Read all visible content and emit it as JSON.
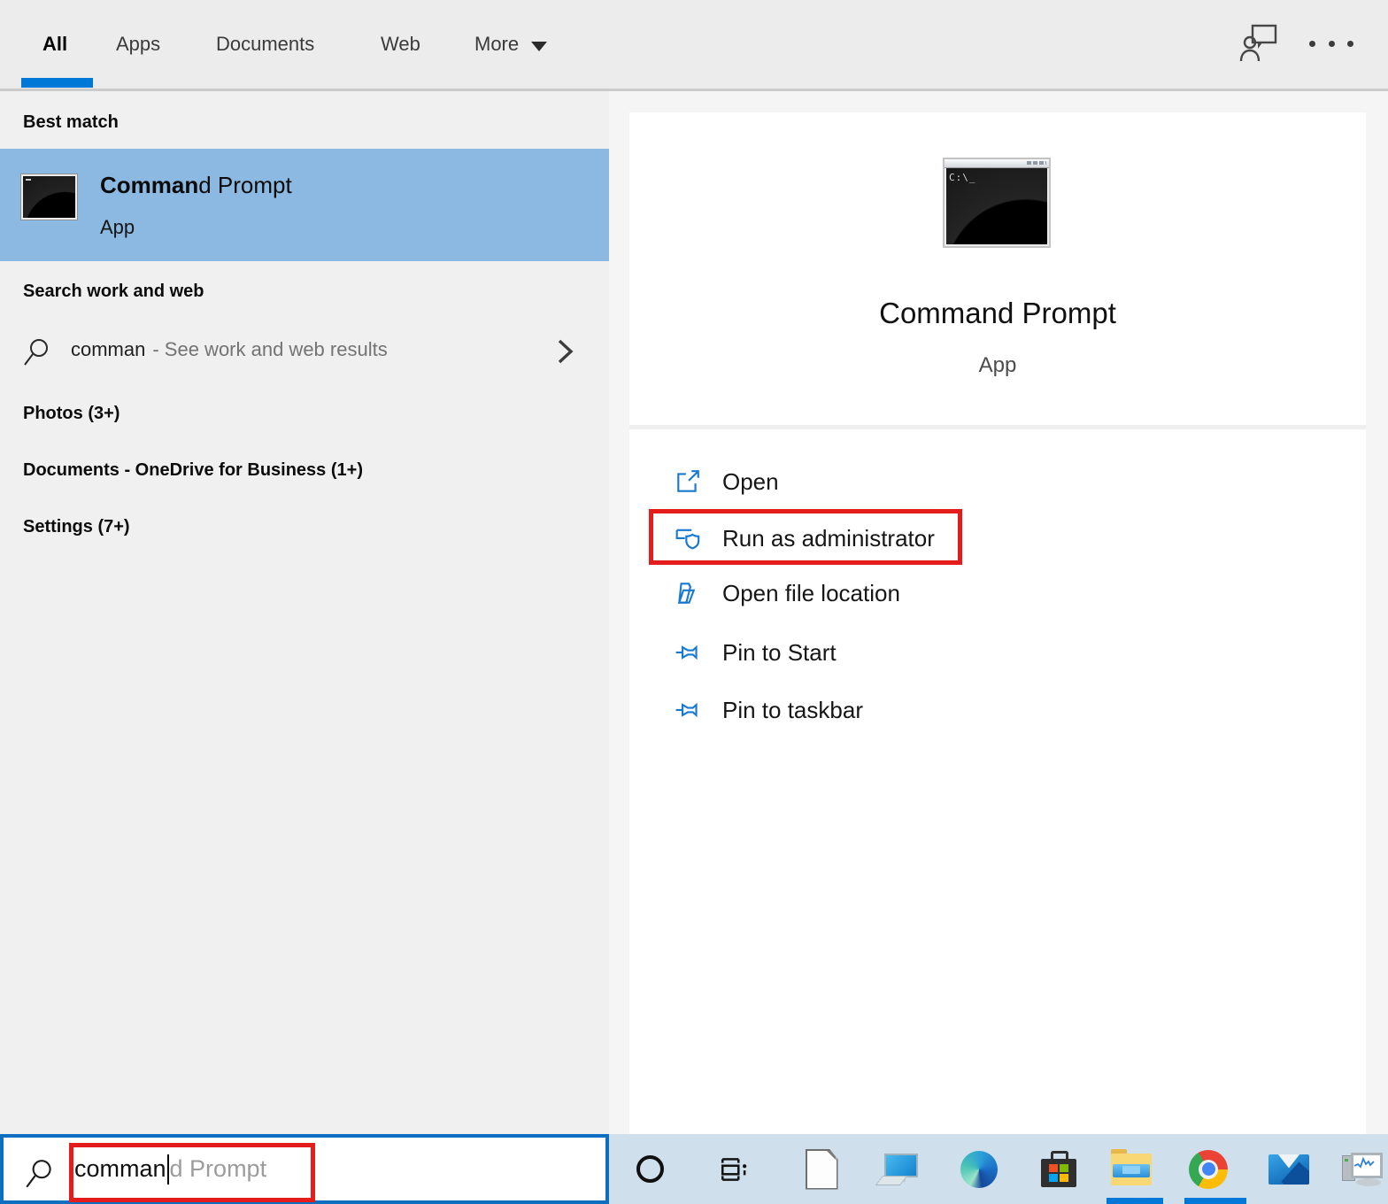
{
  "topbar": {
    "tabs": [
      {
        "label": "All",
        "active": true
      },
      {
        "label": "Apps",
        "active": false
      },
      {
        "label": "Documents",
        "active": false
      },
      {
        "label": "Web",
        "active": false
      },
      {
        "label": "More",
        "active": false,
        "dropdown": true
      }
    ]
  },
  "left_panel": {
    "best_match_header": "Best match",
    "best_match": {
      "title_typed": "Comman",
      "title_rest": "d Prompt",
      "type": "App"
    },
    "web_section_header": "Search work and web",
    "web_result": {
      "query": "comman",
      "hint": "- See work and web results"
    },
    "group_headers": {
      "photos": "Photos (3+)",
      "documents": "Documents - OneDrive for Business (1+)",
      "settings": "Settings (7+)"
    }
  },
  "preview_panel": {
    "app_title": "Command Prompt",
    "app_type": "App",
    "app_icon_text": "C:\\_",
    "actions": [
      {
        "label": "Open"
      },
      {
        "label": "Run as administrator",
        "highlighted": true
      },
      {
        "label": "Open file location"
      },
      {
        "label": "Pin to Start"
      },
      {
        "label": "Pin to taskbar"
      }
    ]
  },
  "search_box": {
    "typed": "comman",
    "suggestion": "d Prompt"
  },
  "taskbar": {
    "icons": [
      "cortana",
      "task-view",
      "libreoffice",
      "this-pc",
      "edge",
      "microsoft-store",
      "file-explorer",
      "chrome",
      "mail",
      "resource-monitor"
    ],
    "running": [
      "file-explorer",
      "chrome"
    ]
  },
  "colors": {
    "accent": "#0078d7",
    "best_match_highlight": "#8cb9e2",
    "annotation_red": "#e41c1c",
    "taskbar_bg": "#cfdfeb",
    "action_icon_blue": "#1779d0"
  }
}
